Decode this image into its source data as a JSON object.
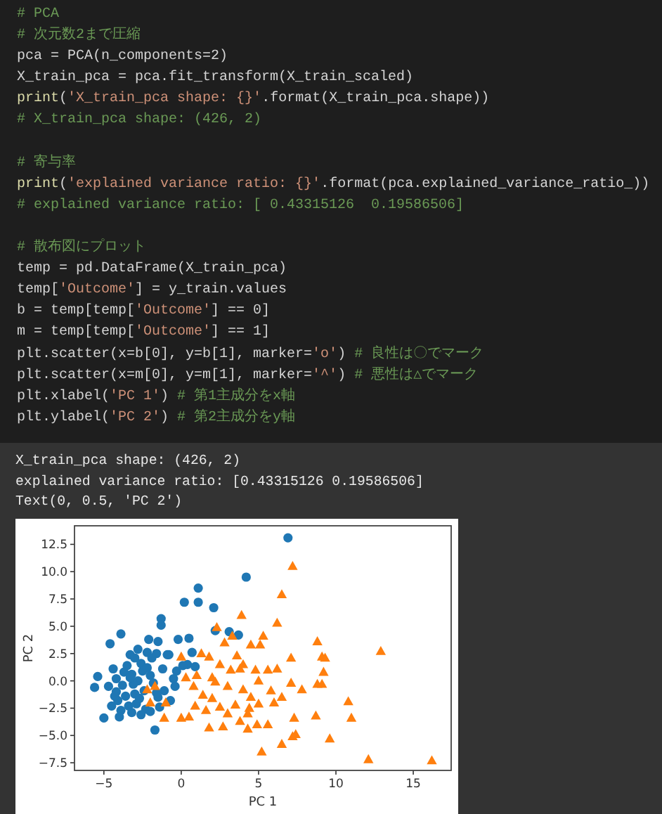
{
  "code_cell": {
    "lines": [
      {
        "kind": "code",
        "segments": [
          {
            "kind": "comment",
            "text": "# PCA"
          }
        ]
      },
      {
        "kind": "code",
        "segments": [
          {
            "kind": "comment",
            "text": "# 次元数2まで圧縮"
          }
        ]
      },
      {
        "kind": "code",
        "segments": [
          {
            "kind": "plain",
            "text": "pca = PCA(n_components=2)"
          }
        ]
      },
      {
        "kind": "code",
        "segments": [
          {
            "kind": "plain",
            "text": "X_train_pca = pca.fit_transform(X_train_scaled)"
          }
        ]
      },
      {
        "kind": "code",
        "segments": [
          {
            "kind": "func",
            "text": "print"
          },
          {
            "kind": "plain",
            "text": "("
          },
          {
            "kind": "string",
            "text": "'X_train_pca shape: {}'"
          },
          {
            "kind": "plain",
            "text": ".format(X_train_pca.shape))"
          }
        ]
      },
      {
        "kind": "code",
        "segments": [
          {
            "kind": "comment",
            "text": "# X_train_pca shape: (426, 2)"
          }
        ]
      },
      {
        "kind": "blank"
      },
      {
        "kind": "code",
        "segments": [
          {
            "kind": "comment",
            "text": "# 寄与率"
          }
        ]
      },
      {
        "kind": "code",
        "segments": [
          {
            "kind": "func",
            "text": "print"
          },
          {
            "kind": "plain",
            "text": "("
          },
          {
            "kind": "string",
            "text": "'explained variance ratio: {}'"
          },
          {
            "kind": "plain",
            "text": ".format(pca.explained_variance_ratio_))"
          }
        ]
      },
      {
        "kind": "code",
        "segments": [
          {
            "kind": "comment",
            "text": "# explained variance ratio: [ 0.43315126  0.19586506]"
          }
        ]
      },
      {
        "kind": "blank"
      },
      {
        "kind": "code",
        "segments": [
          {
            "kind": "comment",
            "text": "# 散布図にプロット"
          }
        ]
      },
      {
        "kind": "code",
        "segments": [
          {
            "kind": "plain",
            "text": "temp = pd.DataFrame(X_train_pca)"
          }
        ]
      },
      {
        "kind": "code",
        "segments": [
          {
            "kind": "plain",
            "text": "temp["
          },
          {
            "kind": "string",
            "text": "'Outcome'"
          },
          {
            "kind": "plain",
            "text": "] = y_train.values"
          }
        ]
      },
      {
        "kind": "code",
        "segments": [
          {
            "kind": "plain",
            "text": "b = temp[temp["
          },
          {
            "kind": "string",
            "text": "'Outcome'"
          },
          {
            "kind": "plain",
            "text": "] == 0]"
          }
        ]
      },
      {
        "kind": "code",
        "segments": [
          {
            "kind": "plain",
            "text": "m = temp[temp["
          },
          {
            "kind": "string",
            "text": "'Outcome'"
          },
          {
            "kind": "plain",
            "text": "] == 1]"
          }
        ]
      },
      {
        "kind": "code",
        "segments": [
          {
            "kind": "plain",
            "text": "plt.scatter(x=b[0], y=b[1], marker="
          },
          {
            "kind": "string",
            "text": "'o'"
          },
          {
            "kind": "plain",
            "text": ") "
          },
          {
            "kind": "comment",
            "text": "# 良性は〇でマーク"
          }
        ]
      },
      {
        "kind": "code",
        "segments": [
          {
            "kind": "plain",
            "text": "plt.scatter(x=m[0], y=m[1], marker="
          },
          {
            "kind": "string",
            "text": "'^'"
          },
          {
            "kind": "plain",
            "text": ") "
          },
          {
            "kind": "comment",
            "text": "# 悪性は△でマーク"
          }
        ]
      },
      {
        "kind": "code",
        "segments": [
          {
            "kind": "plain",
            "text": "plt.xlabel("
          },
          {
            "kind": "string",
            "text": "'PC 1'"
          },
          {
            "kind": "plain",
            "text": ") "
          },
          {
            "kind": "comment",
            "text": "# 第1主成分をx軸"
          }
        ]
      },
      {
        "kind": "code",
        "segments": [
          {
            "kind": "plain",
            "text": "plt.ylabel("
          },
          {
            "kind": "string",
            "text": "'PC 2'"
          },
          {
            "kind": "plain",
            "text": ") "
          },
          {
            "kind": "comment",
            "text": "# 第2主成分をy軸"
          }
        ]
      }
    ]
  },
  "output": {
    "lines": [
      "X_train_pca shape: (426, 2)",
      "explained variance ratio: [0.43315126 0.19586506]",
      "Text(0, 0.5, 'PC 2')"
    ],
    "chart_data": {
      "type": "scatter",
      "xlabel": "PC 1",
      "ylabel": "PC 2",
      "xlim": [
        -6.9,
        17.45
      ],
      "ylim": [
        -8.2,
        14.2
      ],
      "xticks": [
        {
          "value": -5,
          "label": "−5"
        },
        0,
        5,
        10,
        15
      ],
      "yticks": [
        {
          "value": -7.5,
          "label": "−7.5"
        },
        {
          "value": -5,
          "label": "−5.0"
        },
        {
          "value": -2.5,
          "label": "−2.5"
        },
        {
          "value": 0,
          "label": "0.0"
        },
        {
          "value": 2.5,
          "label": "2.5"
        },
        {
          "value": 5,
          "label": "5.0"
        },
        {
          "value": 7.5,
          "label": "7.5"
        },
        {
          "value": 10,
          "label": "10.0"
        },
        {
          "value": 12.5,
          "label": "12.5"
        }
      ],
      "series": [
        {
          "color": "#1f77b4",
          "x": [
            6.9,
            4.2,
            1.1,
            0.2,
            1.1,
            2.1,
            3.1,
            3.7,
            2.2,
            -3.9,
            -4.6,
            -5.4,
            -5.6,
            -1.7,
            -5,
            -1.3,
            -1.3,
            -1.5,
            -2.1,
            -0.2,
            0.5,
            0.4,
            -0.8,
            -3.3,
            -4.4,
            -2.6,
            -2.8,
            -3.5,
            -3,
            -2.2,
            -1.6,
            -0.9,
            -0.3,
            0.1,
            0.9,
            0.7,
            -4.2,
            -4.7,
            -4.2,
            -3.8,
            -3.2,
            -2.5,
            -2,
            -1.2,
            -0.5,
            -4.1,
            -3.6,
            -3,
            -2.4,
            -1.8,
            -1.1,
            -0.4,
            -3.9,
            -3.4,
            -2.9,
            -2.3,
            -1.5,
            -0.7,
            -4.5,
            -4,
            -3.2,
            -2.6,
            -2,
            -1.4,
            -2.8,
            -3.7,
            -4.3,
            -3.1,
            -2.2,
            -1.6,
            -2.7,
            -3.3,
            -1.9
          ],
          "values": [
            13.1,
            9.5,
            8.5,
            7.2,
            7.2,
            6.7,
            4.5,
            4.2,
            4.6,
            4.3,
            3.4,
            0.4,
            -0.6,
            -4.5,
            -3.4,
            5.7,
            5.1,
            3.6,
            3.8,
            3.8,
            3.9,
            1.5,
            2.4,
            2.4,
            1.1,
            1.6,
            2.9,
            1.4,
            2.1,
            2.6,
            2.5,
            2.4,
            0.9,
            1.4,
            1.3,
            2.6,
            0.2,
            -0.5,
            -1,
            -0.4,
            0.6,
            0.9,
            0.5,
            1.1,
            0.2,
            -1.8,
            -1.4,
            -1.2,
            -0.9,
            -0.2,
            -0.9,
            -0.5,
            -2.7,
            -2.3,
            -2.1,
            -2.6,
            -1.5,
            -1.8,
            -2.3,
            -3.3,
            -2.9,
            -3.1,
            -2.8,
            -2.4,
            0,
            0.8,
            -1.4,
            -0.3,
            1.2,
            -1.1,
            -1.6,
            0.3,
            2.1
          ]
        },
        {
          "color": "#ff7f0e",
          "x": [
            7.2,
            6.5,
            3.9,
            6.2,
            2.3,
            8.8,
            12.9,
            9.1,
            9.3,
            7.1,
            9.2,
            11,
            10.8,
            12.1,
            16.2,
            9.6,
            7.3,
            8.7,
            7.2,
            6.5,
            5.2,
            7.4,
            7.8,
            8.8,
            9.1,
            7.1,
            6.2,
            5.6,
            4.8,
            3.8,
            1.3,
            0,
            -2.2,
            -1.7,
            -2,
            -1,
            -1.1,
            0,
            0.5,
            1.8,
            2.7,
            3.8,
            4.3,
            4.9,
            5.6,
            4.3,
            5,
            3.5,
            2,
            2.5,
            1.4,
            3,
            4,
            5.8,
            6.5,
            2,
            1,
            0.8,
            4.5,
            5.1,
            5.3,
            3.3,
            2.8,
            3.6,
            1.8,
            2.5,
            4,
            3.2,
            2.2,
            4.5,
            5,
            0.3,
            0.9,
            1.6,
            3,
            6,
            4.4
          ],
          "values": [
            10.5,
            7.9,
            6,
            5.3,
            4.9,
            3.6,
            2.7,
            2.2,
            2.1,
            2.1,
            0.8,
            -3.4,
            -1.9,
            -7.2,
            -7.3,
            -5.3,
            -3.4,
            -3.2,
            -5.1,
            -5.8,
            -6.5,
            -4.9,
            -0.8,
            -0.3,
            -0.3,
            -0.2,
            1.1,
            1,
            1,
            1.1,
            2.5,
            2.2,
            -0.8,
            -0.5,
            -2,
            -2,
            -3.4,
            -3.4,
            -3.3,
            -4.3,
            -4.2,
            -3.7,
            -4.4,
            -4,
            -4,
            -3,
            -2.1,
            -2.2,
            -1.6,
            -2.4,
            -1.3,
            -0.5,
            -0.8,
            -0.9,
            -1.5,
            0.3,
            0.5,
            -0.5,
            3.3,
            3.3,
            4.1,
            4.1,
            3.5,
            2.3,
            2.2,
            1.5,
            1.5,
            1,
            -0.1,
            -1.5,
            0,
            0.3,
            -2.3,
            -2.7,
            -3,
            -2,
            -2.5
          ]
        }
      ]
    }
  }
}
